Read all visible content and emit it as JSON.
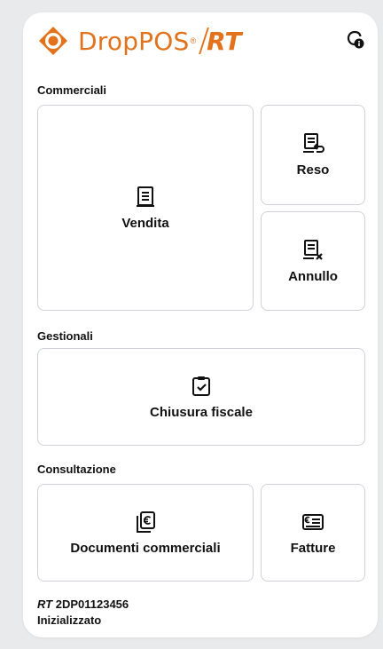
{
  "header": {
    "brand": "DropPOS",
    "registered": "®",
    "suffix": "RT",
    "info_icon": "info-shield-icon",
    "brand_color": "#e2721b"
  },
  "sections": {
    "commerciali": "Commerciali",
    "gestionali": "Gestionali",
    "consultazione": "Consultazione"
  },
  "tiles": {
    "vendita": {
      "label": "Vendita",
      "icon": "receipt-icon"
    },
    "reso": {
      "label": "Reso",
      "icon": "receipt-return-icon"
    },
    "annullo": {
      "label": "Annullo",
      "icon": "receipt-cancel-icon"
    },
    "chiusura": {
      "label": "Chiusura fiscale",
      "icon": "clipboard-check-icon"
    },
    "documenti": {
      "label": "Documenti commerciali",
      "icon": "documents-euro-icon"
    },
    "fatture": {
      "label": "Fatture",
      "icon": "invoice-euro-icon"
    }
  },
  "footer": {
    "rt_label": "RT",
    "serial": "2DP01123456",
    "status": "Inizializzato"
  }
}
